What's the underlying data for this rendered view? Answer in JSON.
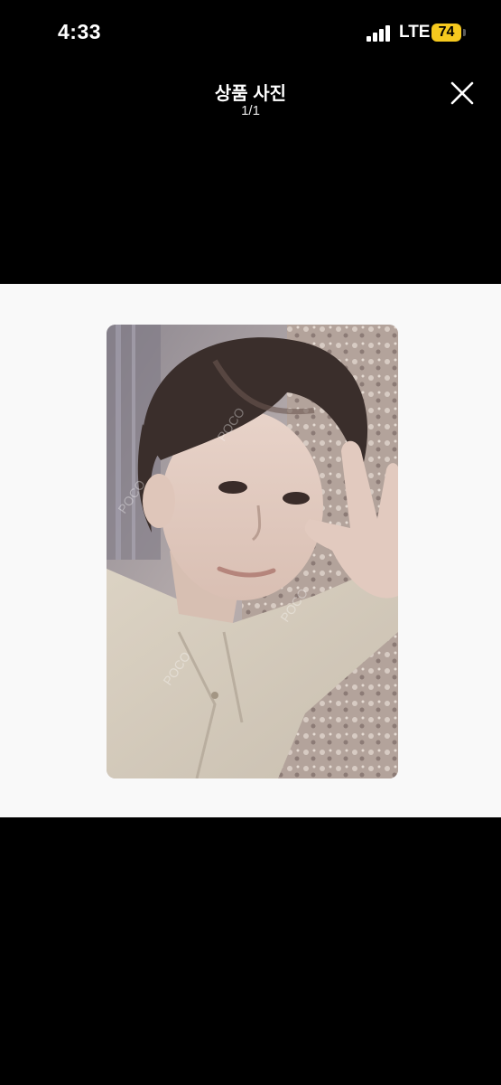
{
  "status_bar": {
    "time": "4:33",
    "network": "LTE",
    "battery": "74"
  },
  "header": {
    "title": "상품 사진",
    "counter": "1/1",
    "close_icon": "close-icon"
  },
  "viewer": {
    "background": "#f9f9f9",
    "photo_icon": "product-photo"
  },
  "colors": {
    "background": "#000000",
    "battery": "#f6c91e"
  }
}
